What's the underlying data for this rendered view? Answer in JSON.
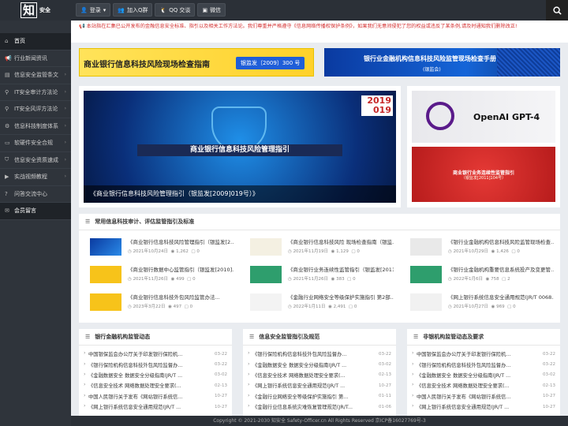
{
  "header": {
    "logo_big": "知",
    "logo_small": "安全",
    "nav": [
      {
        "label": "登录",
        "icon": "user-icon"
      },
      {
        "label": "加入Q群",
        "icon": "group-icon"
      },
      {
        "label": "QQ 交谈",
        "icon": "qq-icon"
      },
      {
        "label": "微信",
        "icon": "wechat-icon"
      }
    ]
  },
  "sidebar": {
    "items": [
      {
        "label": "首页",
        "icon": "home-icon",
        "active": true
      },
      {
        "label": "行业新闻资讯",
        "icon": "megaphone-icon"
      },
      {
        "label": "信息安全监管条文",
        "icon": "book-icon",
        "arrow": true
      },
      {
        "label": "IT安全审计方法论",
        "icon": "search-icon",
        "arrow": true
      },
      {
        "label": "IT安全风评方法论",
        "icon": "search-icon",
        "arrow": true
      },
      {
        "label": "信息科技制度体系",
        "icon": "gear-icon",
        "arrow": true
      },
      {
        "label": "软硬件安全合规",
        "icon": "monitor-icon",
        "arrow": true
      },
      {
        "label": "信息安全资质速成",
        "icon": "shield-icon",
        "arrow": true
      },
      {
        "label": "实战视频教程",
        "icon": "video-icon",
        "arrow": true
      },
      {
        "label": "问答交流中心",
        "icon": "question-icon"
      },
      {
        "label": "会员留言",
        "icon": "chat-icon"
      }
    ]
  },
  "notice": "本站指在汇集已公开发布的金融信息安全标准、指引以及相关工作方法论。我们尊重并严格遵守《信息网络传播权保护条例》，如果我们无意间侵犯了您的权益或违反了某条例,请及时通知我们删除改正!",
  "banners": {
    "left_title": "商业银行信息科技风险现场检查指南",
    "left_tag": "银监发〔2009〕300 号",
    "right_title": "银行业金融机构信息科技风险监管现场检查手册",
    "right_sub": "(银监会)"
  },
  "slider": {
    "year_top": "2019",
    "year_bottom": "019",
    "image_title": "商业银行信息科技风险管理指引",
    "caption": "《商业银行信息科技风险管理指引（银监发[2009]019号）》"
  },
  "ads": {
    "ad1_title": "OpenAI GPT-4",
    "ad2_title": "商业银行业务连续性监管指引",
    "ad2_sub": "（银监发[2011]104号）"
  },
  "guides": {
    "title": "常用信息科技审计、评估监管指引及标准",
    "items": [
      {
        "title": "《商业银行信息科技风险管理指引（银监发[2...",
        "date": "2021年10月24日",
        "views": "1,262",
        "comments": "0",
        "thumb": "blue"
      },
      {
        "title": "《商业银行信息科技风险 现场检查指南（银监...",
        "date": "2021年11月19日",
        "views": "1,129",
        "comments": "0",
        "thumb": "seal"
      },
      {
        "title": "《银行业金融机构信息科技风险监管现场检查...",
        "date": "2021年10月29日",
        "views": "1,426",
        "comments": "0",
        "thumb": "manual"
      },
      {
        "title": "《商业银行数据中心监管指引（银监发[2010]...",
        "date": "2021年11月26日",
        "views": "499",
        "comments": "0",
        "thumb": "yellow"
      },
      {
        "title": "《商业银行业务连续性监管指引（银监发[2011]...",
        "date": "2021年11月26日",
        "views": "383",
        "comments": "0",
        "thumb": "green"
      },
      {
        "title": "《银行业金融机构重要信息系统投产及变更管...",
        "date": "2022年1月6日",
        "views": "758",
        "comments": "2",
        "thumb": "green"
      },
      {
        "title": "《商业银行信息科技外包风险监管办法...",
        "date": "2023年3月22日",
        "views": "497",
        "comments": "0",
        "thumb": "yellow"
      },
      {
        "title": "《金融行业网络安全等级保护实施指引 第2部...",
        "date": "2022年1月11日",
        "views": "2,491",
        "comments": "0",
        "thumb": "doc"
      },
      {
        "title": "《网上银行系统信息安全通用规范(JR/T 0068...",
        "date": "2021年10月27日",
        "views": "969",
        "comments": "0",
        "thumb": "diagram"
      }
    ]
  },
  "panels": [
    {
      "title": "银行金融机构监管动态",
      "rows": [
        {
          "text": "中国银保监会办公厅关于印发银行保险机...",
          "date": "03-22"
        },
        {
          "text": "《银行保险机构信息科技外包风险监督办...",
          "date": "03-22"
        },
        {
          "text": "《金融数据安全 数据安全分级指南(JR/T ...",
          "date": "03-02"
        },
        {
          "text": "《信息安全技术 网络数据处理安全要求(...",
          "date": "02-13"
        },
        {
          "text": "中国人民银行关于发布《网站银行系统信...",
          "date": "10-27"
        },
        {
          "text": "《网上银行系统信息安全通用规范(JR/T ...",
          "date": "10-27"
        }
      ]
    },
    {
      "title": "信息安全监管指引及规范",
      "rows": [
        {
          "text": "《银行保险机构信息科技外包风险监督办...",
          "date": "03-22"
        },
        {
          "text": "《金融数据安全 数据安全分级指南(JR/T ...",
          "date": "03-02"
        },
        {
          "text": "《信息安全技术 网络数据处理安全要求(...",
          "date": "02-13"
        },
        {
          "text": "《网上银行系统信息安全通用规范(JR/T ...",
          "date": "10-27"
        },
        {
          "text": "《金融行业网络安全等级保护实施指引 第...",
          "date": "01-11"
        },
        {
          "text": "《金融行业信息系统灾难恢复管理规范(JR/T...",
          "date": "01-06"
        }
      ]
    },
    {
      "title": "非银机构监管动态及要求",
      "rows": [
        {
          "text": "中国银保监会办公厅关于印发银行保险机...",
          "date": "03-22"
        },
        {
          "text": "《银行保险机构信息科技外包风险监督办...",
          "date": "03-22"
        },
        {
          "text": "《金融数据安全 数据安全分级指南(JR/T ...",
          "date": "03-02"
        },
        {
          "text": "《信息安全技术 网络数据处理安全要求(...",
          "date": "02-13"
        },
        {
          "text": "中国人民银行关于发布《网站银行系统信...",
          "date": "10-27"
        },
        {
          "text": "《网上银行系统信息安全通用规范(JR/T ...",
          "date": "10-27"
        }
      ]
    }
  ],
  "footer": "Copyright © 2021-2030 知安全 Safety-Officer.cn All Rights Reserved  京ICP备16027769号-3"
}
